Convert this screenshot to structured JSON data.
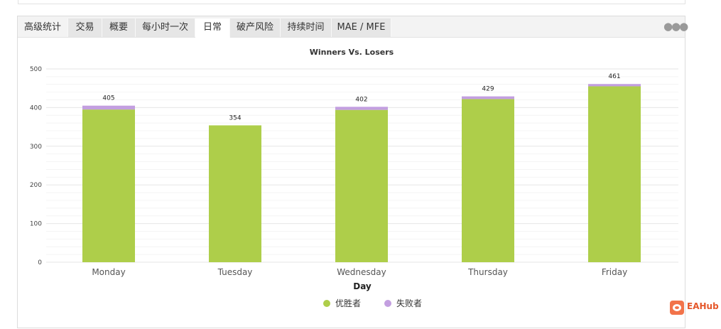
{
  "tabs": [
    {
      "label": "高级统计",
      "active": false
    },
    {
      "label": "交易",
      "active": false
    },
    {
      "label": "概要",
      "active": false
    },
    {
      "label": "每小时一次",
      "active": false
    },
    {
      "label": "日常",
      "active": true
    },
    {
      "label": "破产风险",
      "active": false
    },
    {
      "label": "持续时间",
      "active": false
    },
    {
      "label": "MAE / MFE",
      "active": false
    }
  ],
  "more_icon": "ellipsis-icon",
  "chart_data": {
    "type": "bar",
    "stacked": true,
    "title": "Winners Vs. Losers",
    "xlabel": "Day",
    "ylabel": "",
    "ylim": [
      0,
      500
    ],
    "yticks": [
      0,
      100,
      200,
      300,
      400,
      500
    ],
    "grid": true,
    "legend_position": "bottom-center",
    "categories": [
      "Monday",
      "Tuesday",
      "Wednesday",
      "Thursday",
      "Friday"
    ],
    "totals": [
      405,
      354,
      402,
      429,
      461
    ],
    "series": [
      {
        "name": "优胜者",
        "color": "#aece4a",
        "values": [
          395,
          354,
          394,
          422,
          455
        ]
      },
      {
        "name": "失败者",
        "color": "#c39fe0",
        "values": [
          10,
          0,
          8,
          7,
          6
        ]
      }
    ]
  },
  "logo": {
    "text": "EAHub",
    "icon": "eahub-logo-icon"
  }
}
